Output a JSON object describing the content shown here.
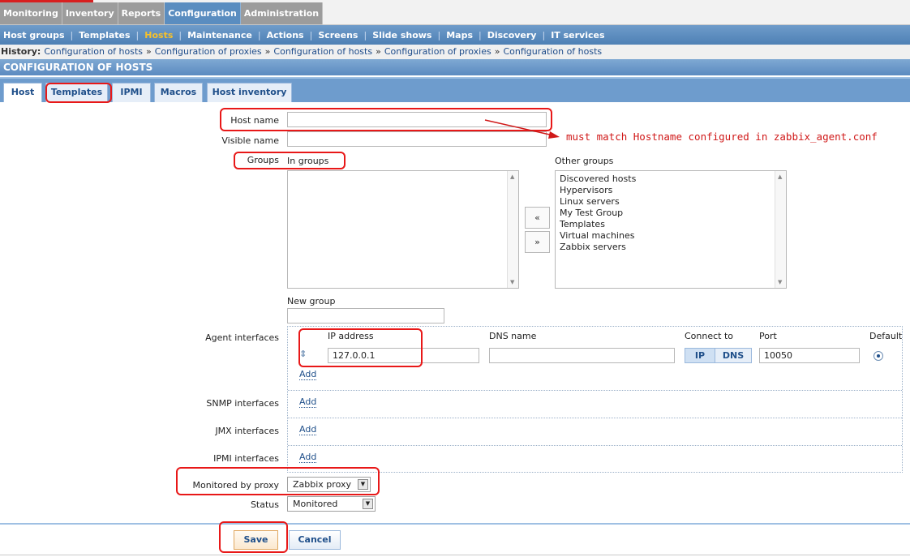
{
  "main_menu": [
    "Monitoring",
    "Inventory",
    "Reports",
    "Configuration",
    "Administration"
  ],
  "sub_menu": [
    "Host groups",
    "Templates",
    "Hosts",
    "Maintenance",
    "Actions",
    "Screens",
    "Slide shows",
    "Maps",
    "Discovery",
    "IT services"
  ],
  "history": {
    "label": "History:",
    "items": [
      "Configuration of hosts",
      "Configuration of proxies",
      "Configuration of hosts",
      "Configuration of proxies",
      "Configuration of hosts"
    ],
    "separator": "»"
  },
  "page_title": "CONFIGURATION OF HOSTS",
  "tabs": [
    "Host",
    "Templates",
    "IPMI",
    "Macros",
    "Host inventory"
  ],
  "form": {
    "host_name": {
      "label": "Host name",
      "value": ""
    },
    "visible_name": {
      "label": "Visible name",
      "value": ""
    },
    "groups": {
      "label": "Groups",
      "in_groups_label": "In groups",
      "in_groups": []
    },
    "other_groups": {
      "label": "Other groups",
      "items": [
        "Discovered hosts",
        "Hypervisors",
        "Linux servers",
        "My Test Group",
        "Templates",
        "Virtual machines",
        "Zabbix servers"
      ]
    },
    "move_left": "«",
    "move_right": "»",
    "new_group": {
      "label": "New group",
      "value": ""
    },
    "agent_interfaces": {
      "label": "Agent interfaces",
      "col_ip": "IP address",
      "col_dns": "DNS name",
      "col_connect": "Connect to",
      "col_port": "Port",
      "col_default": "Default",
      "ip": "127.0.0.1",
      "dns": "",
      "connect_ip": "IP",
      "connect_dns": "DNS",
      "port": "10050",
      "drag_handle": "⇕",
      "add": "Add"
    },
    "snmp_interfaces": {
      "label": "SNMP interfaces",
      "add": "Add"
    },
    "jmx_interfaces": {
      "label": "JMX interfaces",
      "add": "Add"
    },
    "ipmi_interfaces": {
      "label": "IPMI interfaces",
      "add": "Add"
    },
    "monitored_by_proxy": {
      "label": "Monitored by proxy",
      "value": "Zabbix proxy"
    },
    "status": {
      "label": "Status",
      "value": "Monitored"
    }
  },
  "buttons": {
    "save": "Save",
    "cancel": "Cancel"
  },
  "annotation": "must match Hostname configured in zabbix_agent.conf"
}
